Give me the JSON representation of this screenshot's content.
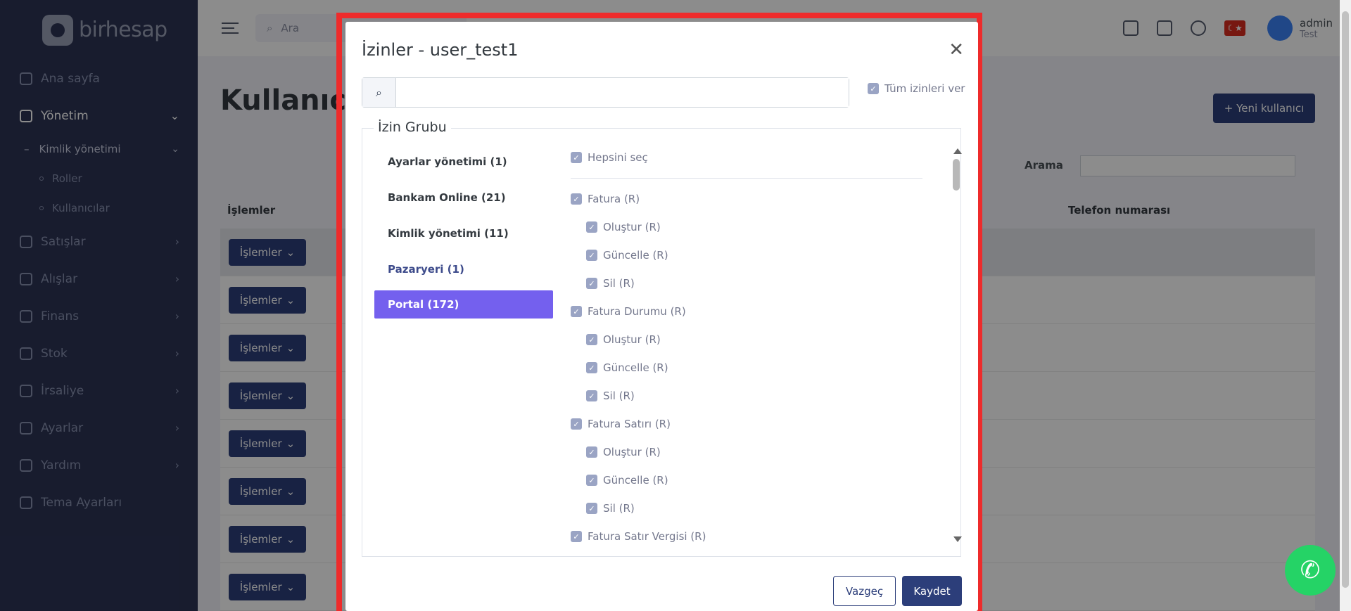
{
  "brand": {
    "name": "birhesap"
  },
  "sidebar": {
    "items": [
      {
        "label": "Ana sayfa",
        "icon": "home-icon",
        "chevron": ""
      },
      {
        "label": "Yönetim",
        "icon": "wrench-icon",
        "chevron": "⌄"
      }
    ],
    "sub": {
      "label": "Kimlik yönetimi",
      "chevron": "⌄"
    },
    "subsub": [
      {
        "label": "Roller"
      },
      {
        "label": "Kullanıcılar"
      }
    ],
    "rest": [
      {
        "label": "Satışlar",
        "icon": "sales-icon"
      },
      {
        "label": "Alışlar",
        "icon": "purchases-icon"
      },
      {
        "label": "Finans",
        "icon": "finance-icon"
      },
      {
        "label": "Stok",
        "icon": "stock-icon"
      },
      {
        "label": "İrsaliye",
        "icon": "waybill-icon"
      },
      {
        "label": "Ayarlar",
        "icon": "settings-icon"
      },
      {
        "label": "Yardım",
        "icon": "help-icon"
      },
      {
        "label": "Tema Ayarları",
        "icon": "theme-icon"
      }
    ]
  },
  "topbar": {
    "search_placeholder": "Ara",
    "user_name": "admin",
    "user_role": "Test"
  },
  "page": {
    "title": "Kullanıcıl",
    "new_user_label": "+ Yeni kullanıcı",
    "search_label": "Arama",
    "columns": {
      "ops": "İşlemler",
      "phone": "Telefon numarası"
    },
    "row_button": "İşlemler",
    "row_count": 8
  },
  "modal": {
    "title": "İzinler - user_test1",
    "grant_all_label": "Tüm izinleri ver",
    "legend": "İzin Grubu",
    "groups": [
      {
        "label": "Ayarlar yönetimi (1)",
        "state": "normal"
      },
      {
        "label": "Bankam Online (21)",
        "state": "normal"
      },
      {
        "label": "Kimlik yönetimi (11)",
        "state": "normal"
      },
      {
        "label": "Pazaryeri (1)",
        "state": "hover"
      },
      {
        "label": "Portal (172)",
        "state": "active"
      }
    ],
    "select_all_label": "Hepsini seç",
    "permissions": [
      {
        "label": "Fatura (R)",
        "level": 0
      },
      {
        "label": "Oluştur (R)",
        "level": 1
      },
      {
        "label": "Güncelle (R)",
        "level": 1
      },
      {
        "label": "Sil (R)",
        "level": 1
      },
      {
        "label": "Fatura Durumu (R)",
        "level": 0
      },
      {
        "label": "Oluştur (R)",
        "level": 1
      },
      {
        "label": "Güncelle (R)",
        "level": 1
      },
      {
        "label": "Sil (R)",
        "level": 1
      },
      {
        "label": "Fatura Satırı (R)",
        "level": 0
      },
      {
        "label": "Oluştur (R)",
        "level": 1
      },
      {
        "label": "Güncelle (R)",
        "level": 1
      },
      {
        "label": "Sil (R)",
        "level": 1
      },
      {
        "label": "Fatura Satır Vergisi (R)",
        "level": 0
      }
    ],
    "cancel_label": "Vazgeç",
    "save_label": "Kaydet"
  },
  "colors": {
    "sidebar_bg": "#2c3355",
    "primary": "#2c3e7a",
    "active_group": "#7460ee",
    "highlight_frame": "#ee2b2b",
    "whatsapp": "#25d366"
  }
}
